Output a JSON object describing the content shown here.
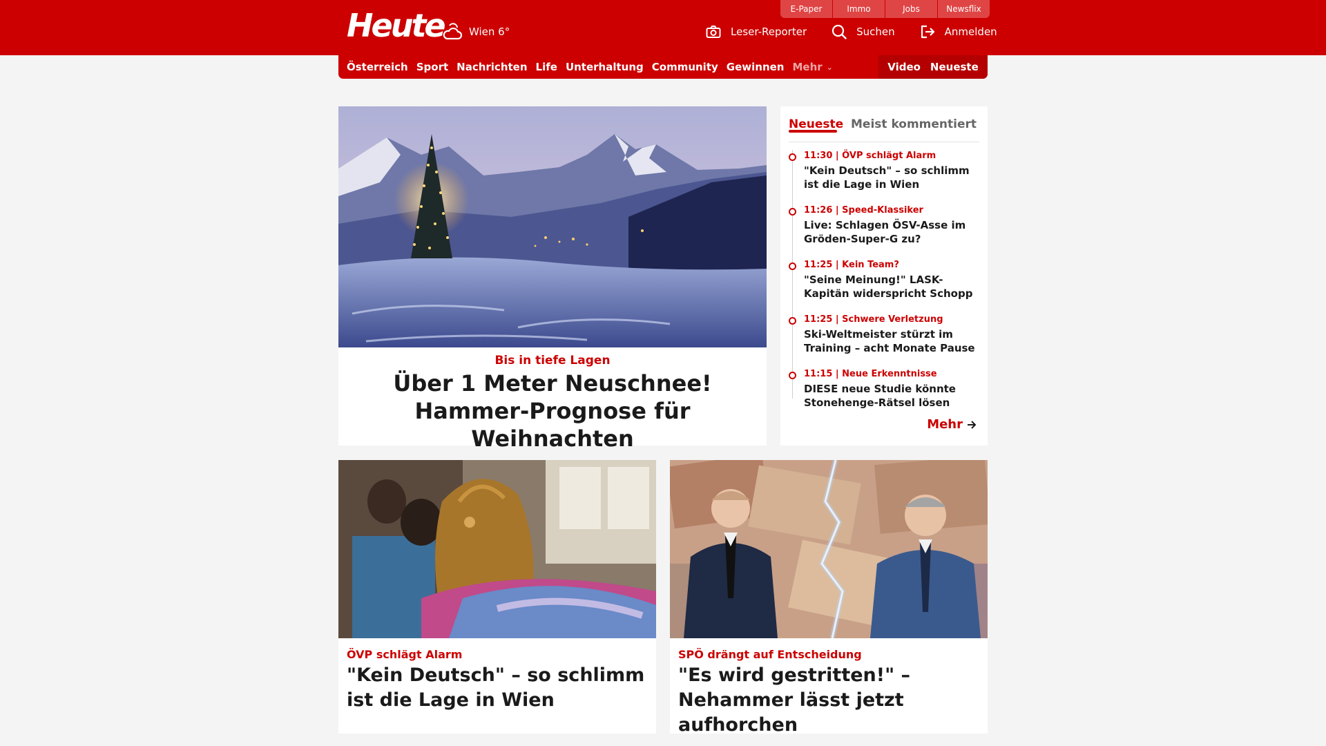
{
  "header": {
    "logo": "Heute",
    "weather": "Wien 6°",
    "service_tabs": [
      "E-Paper",
      "Immo",
      "Jobs",
      "Newsflix"
    ],
    "actions": {
      "reporter": "Leser-Reporter",
      "search": "Suchen",
      "login": "Anmelden"
    },
    "brand_color": "#cc0000"
  },
  "nav": {
    "items": [
      "Österreich",
      "Sport",
      "Nachrichten",
      "Life",
      "Unterhaltung",
      "Community",
      "Gewinnen"
    ],
    "more": "Mehr",
    "right": [
      "Video",
      "Neueste"
    ]
  },
  "hero": {
    "kicker": "Bis in tiefe Lagen",
    "title": "Über 1 Meter Neuschnee! Hammer-Prognose für Weihnachten"
  },
  "latest": {
    "tabs": [
      "Neueste",
      "Meist kommentiert"
    ],
    "items": [
      {
        "meta": "11:30 | ÖVP schlägt Alarm",
        "title": "\"Kein Deutsch\" – so schlimm ist die Lage in Wien"
      },
      {
        "meta": "11:26 | Speed-Klassiker",
        "title": "Live: Schlagen ÖSV-Asse im Gröden-Super-G zu?"
      },
      {
        "meta": "11:25 | Kein Team?",
        "title": "\"Seine Meinung!\" LASK-Kapitän widerspricht Schopp"
      },
      {
        "meta": "11:25 | Schwere Verletzung",
        "title": "Ski-Weltmeister stürzt im Training – acht Monate Pause"
      },
      {
        "meta": "11:15 | Neue Erkenntnisse",
        "title": "DIESE neue Studie könnte Stonehenge-Rätsel lösen"
      }
    ],
    "more": "Mehr"
  },
  "cards": [
    {
      "kicker": "ÖVP schlägt Alarm",
      "title": "\"Kein Deutsch\" – so schlimm ist die Lage in Wien"
    },
    {
      "kicker": "SPÖ drängt auf Entscheidung",
      "title": "\"Es wird gestritten!\" – Nehammer lässt jetzt aufhorchen"
    }
  ]
}
